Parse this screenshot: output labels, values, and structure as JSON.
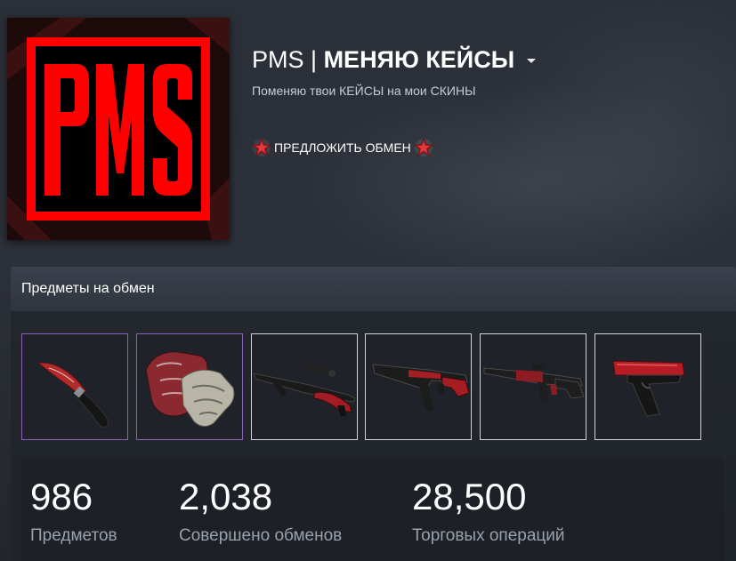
{
  "profile": {
    "avatar_alt": "PMS",
    "persona_prefix": "PMS",
    "persona_separator": "|",
    "persona_main": "МЕНЯЮ КЕЙСЫ",
    "summary": "Поменяю твои КЕЙСЫ на мои СКИНЫ",
    "trade_offer_label": "ПРЕДЛОЖИТЬ ОБМЕН"
  },
  "showcase": {
    "title": "Предметы на обмен",
    "items": [
      {
        "name": "knife-icon",
        "rarity_color": "#8c62b6"
      },
      {
        "name": "gloves-icon",
        "rarity_color": "#8c62b6"
      },
      {
        "name": "sniper-rifle-icon",
        "rarity_color": "#d0d3d8"
      },
      {
        "name": "assault-rifle-ak-icon",
        "rarity_color": "#d0d3d8"
      },
      {
        "name": "assault-rifle-m4-icon",
        "rarity_color": "#d0d3d8"
      },
      {
        "name": "pistol-icon",
        "rarity_color": "#d0d3d8"
      }
    ]
  },
  "stats": [
    {
      "value": "986",
      "label": "Предметов"
    },
    {
      "value": "2,038",
      "label": "Совершено обменов"
    },
    {
      "value": "28,500",
      "label": "Торговых операций"
    }
  ],
  "colors": {
    "accent_red": "#ff0000",
    "rarity_purple": "#8c62b6",
    "background": "#2b2f37"
  }
}
